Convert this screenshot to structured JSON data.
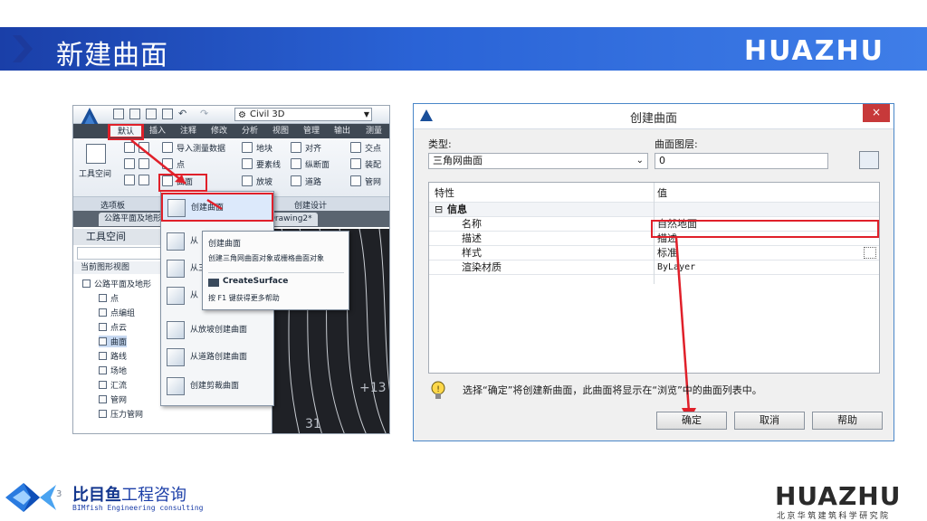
{
  "slide": {
    "title": "新建曲面",
    "header_logo": "HUAZHU"
  },
  "civil3d": {
    "workspace": "Civil 3D",
    "ribbon_tabs": [
      "默认",
      "插入",
      "注释",
      "修改",
      "分析",
      "视图",
      "管理",
      "输出",
      "测量"
    ],
    "ribbon": {
      "toolspace_label": "工具空间",
      "import_survey": "导入测量数据",
      "points": "点",
      "surface": "曲面",
      "site": "地块",
      "feature_line": "要素线",
      "grading": "放坡",
      "align": "对齐",
      "profile": "纵断面",
      "corridor": "道路",
      "intersection": "交点",
      "assembly": "装配",
      "pipe_network": "管网",
      "panel_palettes": "选项板",
      "panel_create_design": "创建设计"
    },
    "doc_tabs": [
      "公路平面及地形",
      "Drawing2*"
    ],
    "toolspace": {
      "title": "工具空间",
      "view_label": "当前图形视图",
      "tree": [
        "公路平面及地形",
        "点",
        "点编组",
        "点云",
        "曲面",
        "路线",
        "场地",
        "汇流",
        "管网",
        "压力管网"
      ]
    },
    "menu_items": [
      "创建曲面",
      "从",
      "从三",
      "从",
      "从放坡创建曲面",
      "从道路创建曲面",
      "创建剪裁曲面"
    ],
    "tooltip": {
      "title": "创建曲面",
      "desc": "创建三角网曲面对象或栅格曲面对象",
      "command": "CreateSurface",
      "help": "按 F1 键获得更多帮助"
    },
    "drawing_labels": [
      "+13",
      "31"
    ]
  },
  "dialog": {
    "title": "创建曲面",
    "close": "×",
    "type_label": "类型:",
    "type_value": "三角网曲面",
    "layer_label": "曲面图层:",
    "layer_value": "0",
    "grid_header_prop": "特性",
    "grid_header_value": "值",
    "group": "信息",
    "rows": [
      {
        "prop": "名称",
        "value": "自然地面"
      },
      {
        "prop": "描述",
        "value": "描述"
      },
      {
        "prop": "样式",
        "value": "标准"
      },
      {
        "prop": "渲染材质",
        "value": "ByLayer"
      }
    ],
    "info": "选择“确定”将创建新曲面，此曲面将显示在“浏览”中的曲面列表中。",
    "buttons": {
      "ok": "确定",
      "cancel": "取消",
      "help": "帮助"
    }
  },
  "footer": {
    "bimfish_cn_strong": "比目鱼",
    "bimfish_cn_rest": "工程咨询",
    "bimfish_en": "BIMfish Engineering consulting",
    "page_number": "3",
    "huazhu": "HUAZHU",
    "institute": "北京华筑建筑科学研究院"
  },
  "colors": {
    "header_blue": "#2a63d6",
    "highlight_red": "#e0202a",
    "bimfish_blue": "#1c3fa8"
  }
}
